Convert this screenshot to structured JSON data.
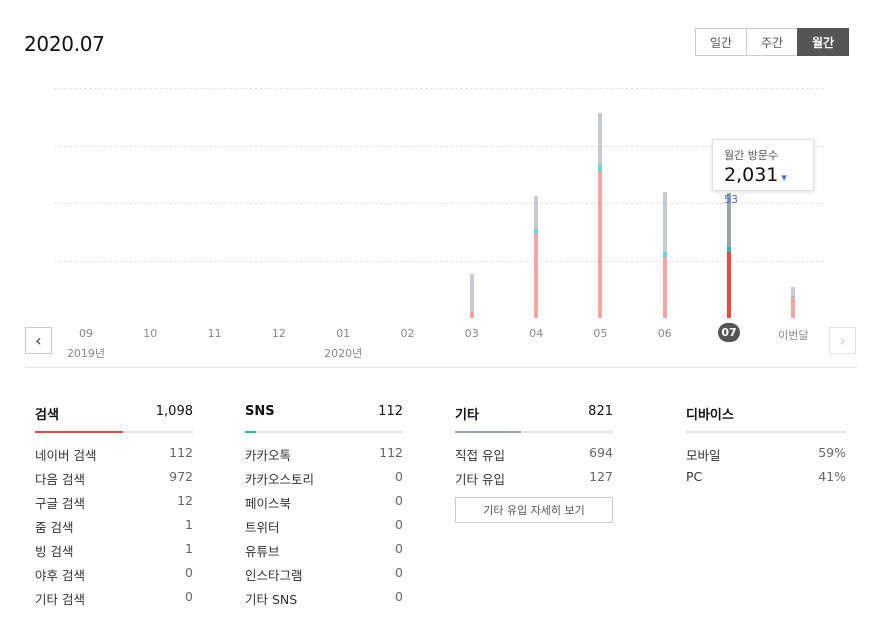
{
  "header": {
    "title": "2020.07"
  },
  "period_tabs": [
    {
      "label": "일간",
      "active": false
    },
    {
      "label": "주간",
      "active": false
    },
    {
      "label": "월간",
      "active": true
    }
  ],
  "colors": {
    "search": "#f4a79f",
    "search_selected": "#f1463e",
    "sns": "#6fd6c8",
    "sns_selected": "#1cbfa3",
    "other": "#c5cbd1",
    "other_selected": "#9aa2ad"
  },
  "chart_data": {
    "type": "bar",
    "stacked": true,
    "categories": [
      "09",
      "10",
      "11",
      "12",
      "01",
      "02",
      "03",
      "04",
      "05",
      "06",
      "07",
      "이번달"
    ],
    "year_labels": [
      {
        "label": "2019년",
        "at": "09"
      },
      {
        "label": "2020년",
        "at": "01"
      }
    ],
    "selected": "07",
    "series": [
      {
        "key": "search",
        "values": [
          0,
          0,
          0,
          0,
          0,
          0,
          80,
          1100,
          1900,
          790,
          860,
          280
        ]
      },
      {
        "key": "sns",
        "values": [
          0,
          0,
          0,
          0,
          0,
          0,
          0,
          55,
          100,
          70,
          70,
          10
        ]
      },
      {
        "key": "other",
        "values": [
          0,
          0,
          0,
          0,
          0,
          0,
          500,
          430,
          680,
          780,
          700,
          110
        ]
      }
    ],
    "ylim": [
      0,
      3000
    ],
    "grid": true,
    "legend": "none"
  },
  "tooltip": {
    "label": "월간 방문수",
    "value": "2,031",
    "change_arrow": "▾",
    "change": "53"
  },
  "nav": {
    "prev": "‹",
    "next": "›"
  },
  "stats": [
    {
      "title": "검색",
      "total": "1,098",
      "color": "#f1463e",
      "fill": 0.56,
      "rows": [
        [
          "네이버 검색",
          "112"
        ],
        [
          "다음 검색",
          "972"
        ],
        [
          "구글 검색",
          "12"
        ],
        [
          "줌 검색",
          "1"
        ],
        [
          "빙 검색",
          "1"
        ],
        [
          "야후 검색",
          "0"
        ],
        [
          "기타 검색",
          "0"
        ]
      ]
    },
    {
      "title": "SNS",
      "total": "112",
      "color": "#1cbfa3",
      "fill": 0.07,
      "rows": [
        [
          "카카오톡",
          "112"
        ],
        [
          "카카오스토리",
          "0"
        ],
        [
          "페이스북",
          "0"
        ],
        [
          "트위터",
          "0"
        ],
        [
          "유튜브",
          "0"
        ],
        [
          "인스타그램",
          "0"
        ],
        [
          "기타 SNS",
          "0"
        ]
      ]
    },
    {
      "title": "기타",
      "total": "821",
      "color": "#9aa2ad",
      "fill": 0.42,
      "rows": [
        [
          "직접 유입",
          "694"
        ],
        [
          "기타 유입",
          "127"
        ]
      ],
      "button": "기타 유입 자세히 보기"
    },
    {
      "title": "디바이스",
      "total": "",
      "color": "#9aa2ad",
      "fill": 0,
      "rows": [
        [
          "모바일",
          "59%"
        ],
        [
          "PC",
          "41%"
        ]
      ]
    }
  ]
}
